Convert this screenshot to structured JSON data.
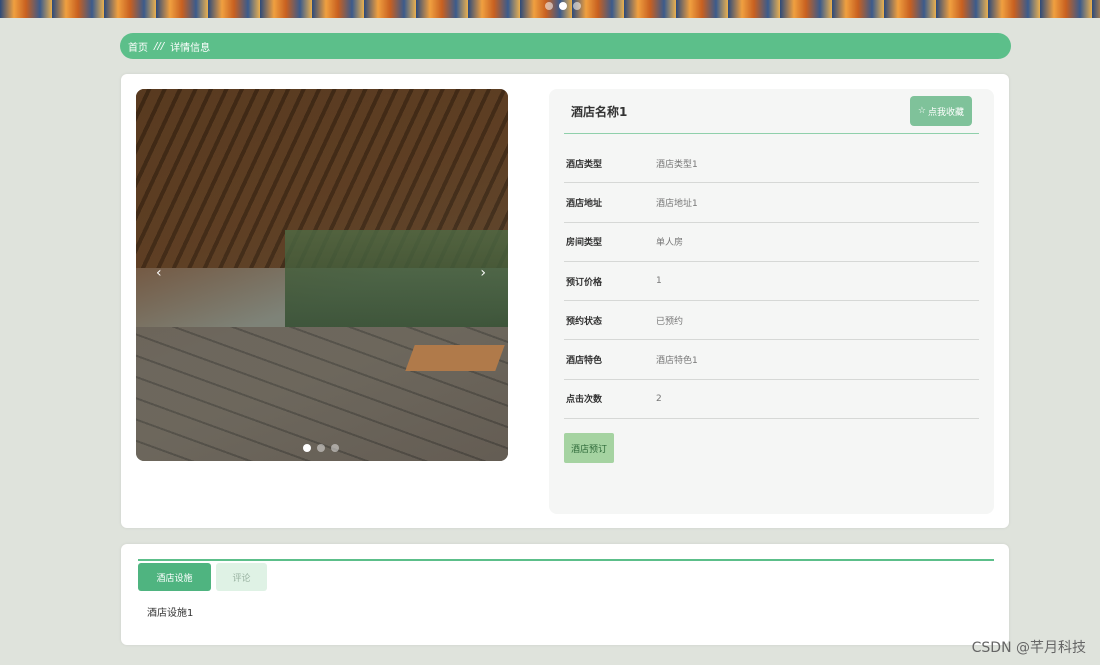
{
  "breadcrumb": {
    "home": "首页",
    "separator": "///",
    "current": "详情信息"
  },
  "hotel": {
    "name": "酒店名称1",
    "favorite_label": "点我收藏",
    "favorite_icon": "star-outline-icon",
    "book_label": "酒店预订",
    "fields": [
      {
        "label": "酒店类型",
        "value": "酒店类型1"
      },
      {
        "label": "酒店地址",
        "value": "酒店地址1"
      },
      {
        "label": "房间类型",
        "value": "单人房"
      },
      {
        "label": "预订价格",
        "value": "1"
      },
      {
        "label": "预约状态",
        "value": "已预约"
      },
      {
        "label": "酒店特色",
        "value": "酒店特色1"
      },
      {
        "label": "点击次数",
        "value": "2"
      }
    ]
  },
  "tabs": [
    {
      "label": "酒店设施",
      "active": true
    },
    {
      "label": "评论",
      "active": false
    }
  ],
  "tab_content": "酒店设施1",
  "watermark": "CSDN @芊月科技",
  "colors": {
    "accent": "#5cbf8a",
    "fav_button": "#7fc29a",
    "book_button": "#a5d3a1"
  }
}
